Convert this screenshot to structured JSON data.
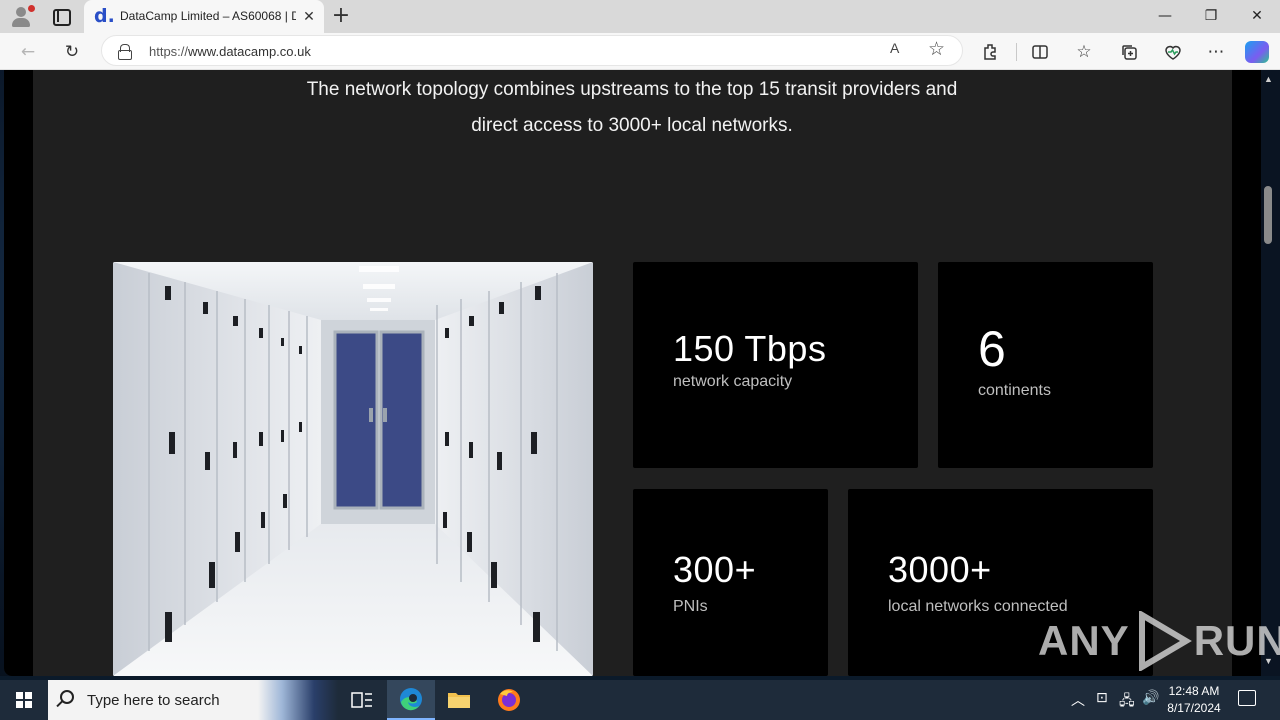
{
  "browser": {
    "tab_title": "DataCamp Limited – AS60068 | D",
    "favicon_glyph": "d.",
    "tab_close": "✕",
    "new_tab": "+",
    "url_scheme": "https://",
    "url_host": "www.datacamp.co.uk",
    "read_aloud": "A",
    "favorite_star": "☆",
    "window_controls": {
      "minimize": "—",
      "maximize": "❐",
      "close": "✕"
    },
    "toolbar_icons": [
      "extensions-icon",
      "split-screen-icon",
      "favorites-icon",
      "collections-icon",
      "browser-essentials-icon",
      "more-icon"
    ]
  },
  "page": {
    "intro_line1": "The network topology combines upstreams to the top 15 transit providers and",
    "intro_line2": "direct access to 3000+ local networks.",
    "stats": [
      {
        "value": "150 Tbps",
        "label": "network capacity"
      },
      {
        "value": "6",
        "label": "continents"
      },
      {
        "value": "300+",
        "label": "PNIs"
      },
      {
        "value": "3000+",
        "label": "local networks connected"
      }
    ]
  },
  "watermark": {
    "left": "ANY",
    "right": "RUN"
  },
  "taskbar": {
    "search_placeholder": "Type here to search",
    "time": "12:48 AM",
    "date": "8/17/2024"
  },
  "colors": {
    "page_bg": "#1f1f1f",
    "stat_card": "#000000",
    "tab_favicon": "#2a4fc7",
    "taskbar": "#1e2b3a"
  }
}
